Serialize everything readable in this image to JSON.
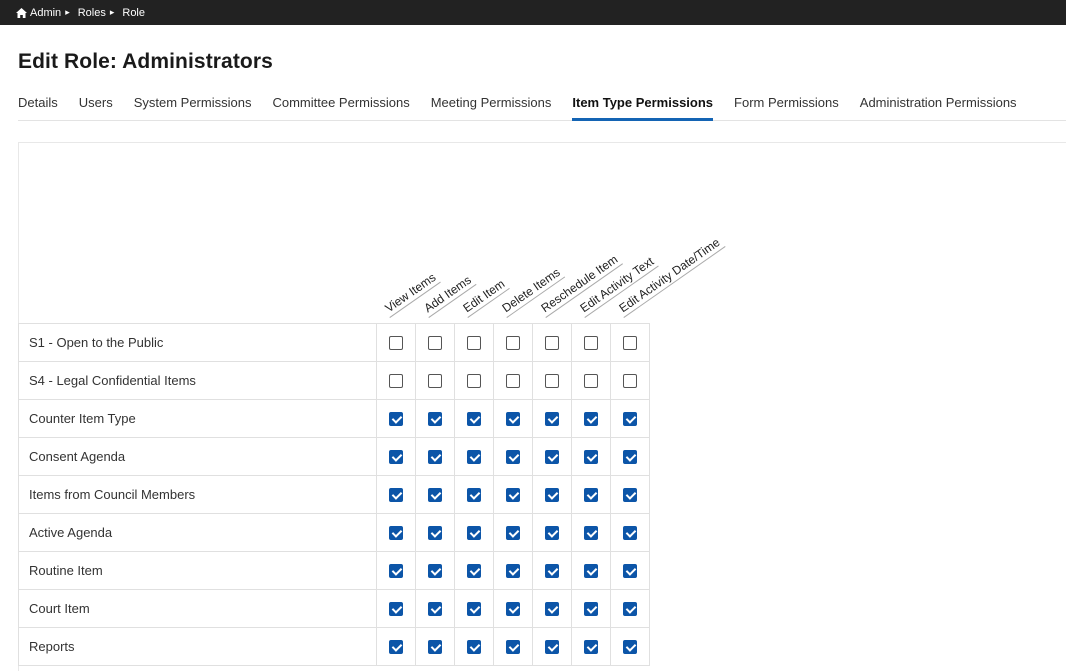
{
  "breadcrumb": {
    "items": [
      "Admin",
      "Roles",
      "Role"
    ]
  },
  "page": {
    "title": "Edit Role: Administrators"
  },
  "tabs": [
    {
      "label": "Details",
      "active": false
    },
    {
      "label": "Users",
      "active": false
    },
    {
      "label": "System Permissions",
      "active": false
    },
    {
      "label": "Committee Permissions",
      "active": false
    },
    {
      "label": "Meeting Permissions",
      "active": false
    },
    {
      "label": "Item Type Permissions",
      "active": true
    },
    {
      "label": "Form Permissions",
      "active": false
    },
    {
      "label": "Administration Permissions",
      "active": false
    }
  ],
  "columns": [
    "View Items",
    "Add Items",
    "Edit Item",
    "Delete Items",
    "Reschedule Item",
    "Edit Activity Text",
    "Edit Activity Date/Time"
  ],
  "rows": [
    {
      "label": "S1 - Open to the Public",
      "checks": [
        false,
        false,
        false,
        false,
        false,
        false,
        false
      ]
    },
    {
      "label": "S4 - Legal Confidential Items",
      "checks": [
        false,
        false,
        false,
        false,
        false,
        false,
        false
      ]
    },
    {
      "label": "Counter Item Type",
      "checks": [
        true,
        true,
        true,
        true,
        true,
        true,
        true
      ]
    },
    {
      "label": "Consent Agenda",
      "checks": [
        true,
        true,
        true,
        true,
        true,
        true,
        true
      ]
    },
    {
      "label": "Items from Council Members",
      "checks": [
        true,
        true,
        true,
        true,
        true,
        true,
        true
      ]
    },
    {
      "label": "Active Agenda",
      "checks": [
        true,
        true,
        true,
        true,
        true,
        true,
        true
      ]
    },
    {
      "label": "Routine Item",
      "checks": [
        true,
        true,
        true,
        true,
        true,
        true,
        true
      ]
    },
    {
      "label": "Court Item",
      "checks": [
        true,
        true,
        true,
        true,
        true,
        true,
        true
      ]
    },
    {
      "label": "Reports",
      "checks": [
        true,
        true,
        true,
        true,
        true,
        true,
        true
      ]
    }
  ],
  "colors": {
    "topbar": "#222222",
    "accent": "#1464b4",
    "checkbox_checked": "#0c55a8"
  },
  "icons": {
    "breadcrumb_home": "home-icon",
    "breadcrumb_separator": "chevron-right-icon"
  }
}
